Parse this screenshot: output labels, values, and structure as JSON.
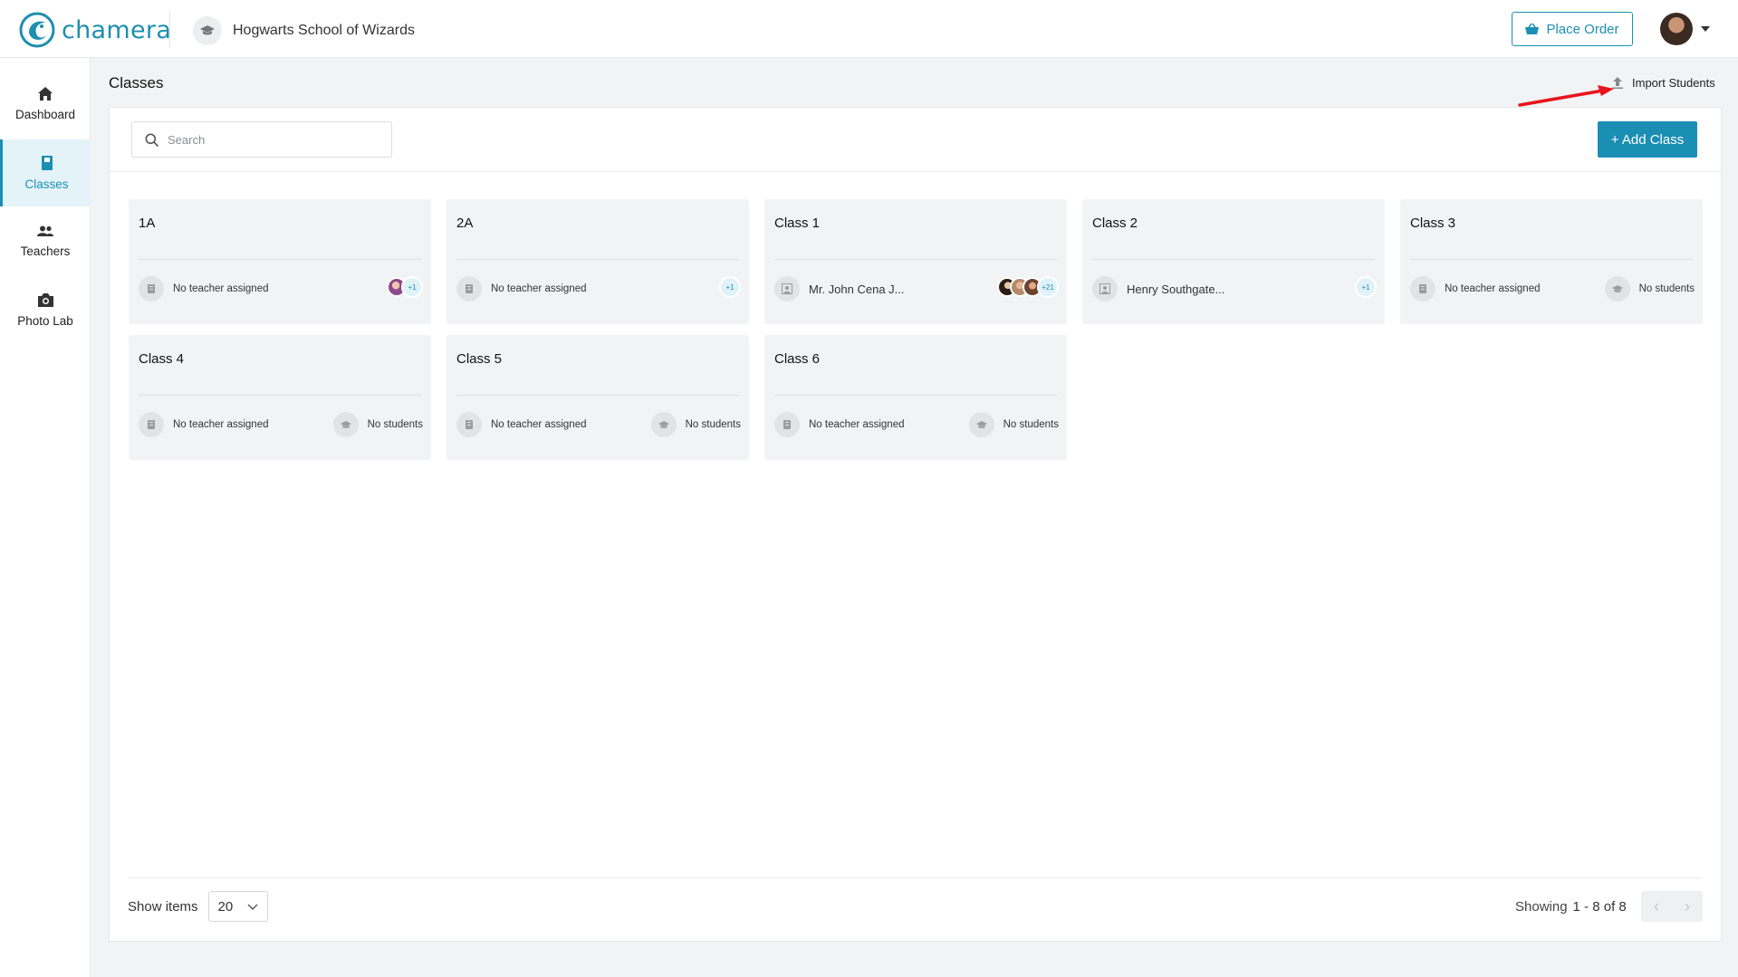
{
  "app": {
    "logo_text": "chamera",
    "school_name": "Hogwarts School of Wizards",
    "place_order_label": "Place Order",
    "brand_color": "#1b8fb3"
  },
  "sidebar": {
    "items": [
      {
        "label": "Dashboard",
        "icon": "home-icon",
        "active": false
      },
      {
        "label": "Classes",
        "icon": "book-icon",
        "active": true
      },
      {
        "label": "Teachers",
        "icon": "people-icon",
        "active": false
      },
      {
        "label": "Photo Lab",
        "icon": "camera-icon",
        "active": false
      }
    ]
  },
  "page": {
    "title": "Classes",
    "import_label": "Import Students",
    "search_placeholder": "Search",
    "add_class_label": "+ Add Class"
  },
  "classes": [
    {
      "name": "1A",
      "teacher": "No teacher assigned",
      "students": "+1"
    },
    {
      "name": "2A",
      "teacher": "No teacher assigned",
      "students": "+1"
    },
    {
      "name": "Class 1",
      "teacher": "Mr. John Cena J...",
      "students": "+21"
    },
    {
      "name": "Class 2",
      "teacher": "Henry Southgate...",
      "students": "+1"
    },
    {
      "name": "Class 3",
      "teacher": "No teacher assigned",
      "students": "No students"
    },
    {
      "name": "Class 4",
      "teacher": "No teacher assigned",
      "students": "No students"
    },
    {
      "name": "Class 5",
      "teacher": "No teacher assigned",
      "students": "No students"
    },
    {
      "name": "Class 6",
      "teacher": "No teacher assigned",
      "students": "No students"
    }
  ],
  "footer": {
    "show_items_label": "Show items",
    "page_size": "20",
    "showing_label": "Showing",
    "range": "1 - 8 of 8"
  }
}
